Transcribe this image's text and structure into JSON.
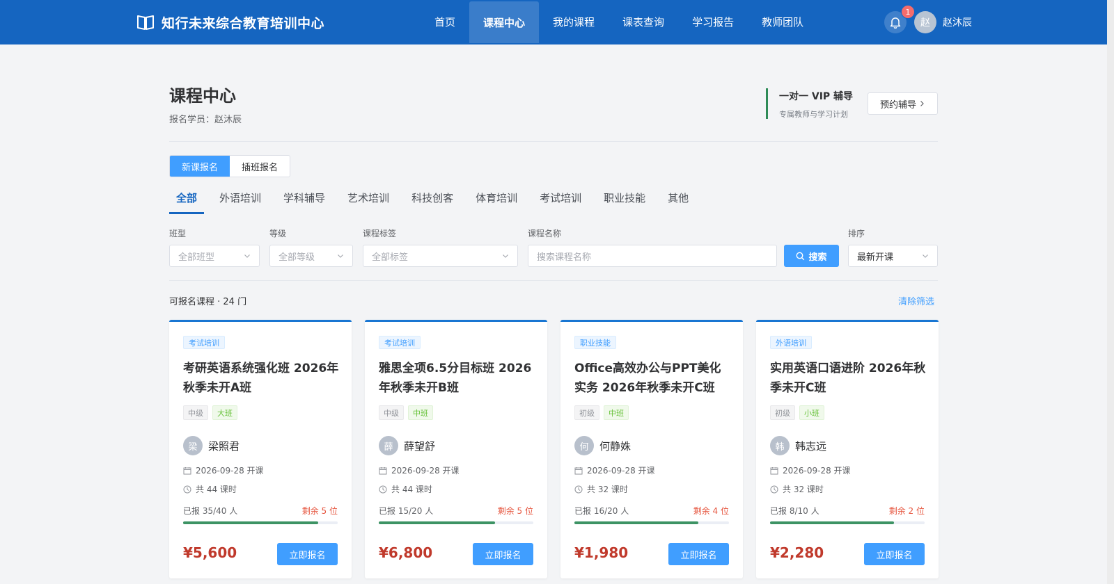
{
  "header": {
    "title": "知行未来综合教育培训中心",
    "nav": [
      {
        "label": "首页",
        "active": false
      },
      {
        "label": "课程中心",
        "active": true
      },
      {
        "label": "我的课程",
        "active": false
      },
      {
        "label": "课表查询",
        "active": false
      },
      {
        "label": "学习报告",
        "active": false
      },
      {
        "label": "教师团队",
        "active": false
      }
    ],
    "notification_count": "1",
    "user_avatar": "赵",
    "user_name": "赵沐辰"
  },
  "page": {
    "title": "课程中心",
    "subtitle": "报名学员：赵沐辰",
    "vip_title": "一对一 VIP 辅导",
    "vip_sub": "专属教师与学习计划",
    "vip_button": "预约辅导"
  },
  "mode_tabs": [
    {
      "label": "新课报名",
      "active": true
    },
    {
      "label": "插班报名",
      "active": false
    }
  ],
  "categories": [
    "全部",
    "外语培训",
    "学科辅导",
    "艺术培训",
    "科技创客",
    "体育培训",
    "考试培训",
    "职业技能",
    "其他"
  ],
  "filters": {
    "class_type_label": "班型",
    "class_type_value": "全部班型",
    "level_label": "等级",
    "level_value": "全部等级",
    "tag_label": "课程标签",
    "tag_value": "全部标签",
    "name_label": "课程名称",
    "name_placeholder": "搜索课程名称",
    "search_button": "搜索",
    "sort_label": "排序",
    "sort_value": "最新开课"
  },
  "list": {
    "count_text": "可报名课程 · 24 门",
    "clear_text": "清除筛选"
  },
  "courses": [
    {
      "category": "考试培训",
      "title": "考研英语系统强化班 2026年秋季未开A班",
      "level": "中级",
      "size": "大班",
      "teacher_initial": "梁",
      "teacher": "梁照君",
      "start": "2026-09-28 开课",
      "hours": "共 44 课时",
      "enrolled": "已报 35/40 人",
      "remaining": "剩余 5 位",
      "progress": 0.875,
      "price": "¥5,600",
      "button": "立即报名"
    },
    {
      "category": "考试培训",
      "title": "雅思全项6.5分目标班 2026年秋季未开B班",
      "level": "中级",
      "size": "中班",
      "teacher_initial": "薛",
      "teacher": "薛望舒",
      "start": "2026-09-28 开课",
      "hours": "共 44 课时",
      "enrolled": "已报 15/20 人",
      "remaining": "剩余 5 位",
      "progress": 0.75,
      "price": "¥6,800",
      "button": "立即报名"
    },
    {
      "category": "职业技能",
      "title": "Office高效办公与PPT美化实务 2026年秋季未开C班",
      "level": "初级",
      "size": "中班",
      "teacher_initial": "何",
      "teacher": "何静姝",
      "start": "2026-09-28 开课",
      "hours": "共 32 课时",
      "enrolled": "已报 16/20 人",
      "remaining": "剩余 4 位",
      "progress": 0.8,
      "price": "¥1,980",
      "button": "立即报名"
    },
    {
      "category": "外语培训",
      "title": "实用英语口语进阶 2026年秋季未开C班",
      "level": "初级",
      "size": "小班",
      "teacher_initial": "韩",
      "teacher": "韩志远",
      "start": "2026-09-28 开课",
      "hours": "共 32 课时",
      "enrolled": "已报 8/10 人",
      "remaining": "剩余 2 位",
      "progress": 0.8,
      "price": "¥2,280",
      "button": "立即报名"
    }
  ],
  "colors": {
    "header_bg": "#1565c0",
    "primary": "#409eff",
    "price": "#c0392b",
    "progress": "#3d9364",
    "remaining": "#e6543d"
  }
}
